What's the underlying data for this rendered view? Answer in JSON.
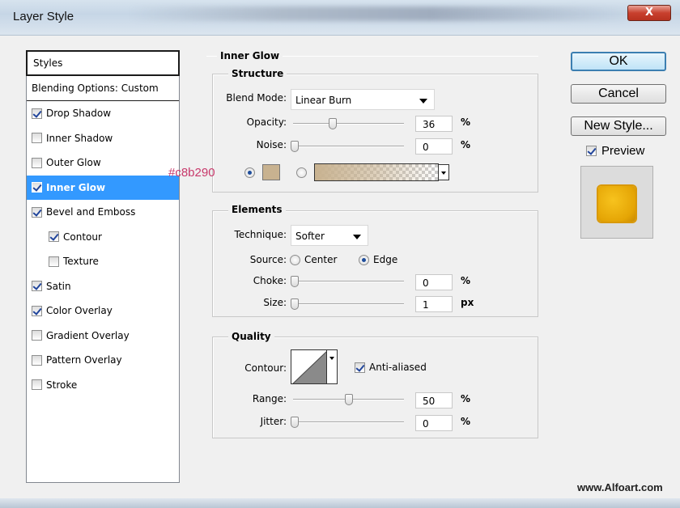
{
  "window": {
    "title": "Layer Style",
    "close_glyph": "X"
  },
  "styles_panel": {
    "header": "Styles",
    "blending_options": "Blending Options: Custom",
    "items": [
      {
        "label": "Drop Shadow",
        "checked": true
      },
      {
        "label": "Inner Shadow",
        "checked": false
      },
      {
        "label": "Outer Glow",
        "checked": false
      },
      {
        "label": "Inner Glow",
        "checked": true,
        "selected": true
      },
      {
        "label": "Bevel and Emboss",
        "checked": true
      },
      {
        "label": "Contour",
        "checked": true,
        "indent": true
      },
      {
        "label": "Texture",
        "checked": false,
        "indent": true
      },
      {
        "label": "Satin",
        "checked": true
      },
      {
        "label": "Color Overlay",
        "checked": true
      },
      {
        "label": "Gradient Overlay",
        "checked": false
      },
      {
        "label": "Pattern Overlay",
        "checked": false
      },
      {
        "label": "Stroke",
        "checked": false
      }
    ]
  },
  "inner_glow": {
    "title": "Inner Glow",
    "structure": {
      "title": "Structure",
      "blend_mode_label": "Blend Mode:",
      "blend_mode_value": "Linear Burn",
      "opacity_label": "Opacity:",
      "opacity_value": "36",
      "opacity_level": 0.36,
      "opacity_unit": "%",
      "noise_label": "Noise:",
      "noise_value": "0",
      "noise_unit": "%",
      "color_annotation": "#c8b290",
      "glow_color": "#c8b290",
      "solid_color_selected": true
    },
    "elements": {
      "title": "Elements",
      "technique_label": "Technique:",
      "technique_value": "Softer",
      "source_label": "Source:",
      "source_center": "Center",
      "source_edge": "Edge",
      "source_selected": "Edge",
      "choke_label": "Choke:",
      "choke_value": "0",
      "choke_unit": "%",
      "size_label": "Size:",
      "size_value": "1",
      "size_unit": "px"
    },
    "quality": {
      "title": "Quality",
      "contour_label": "Contour:",
      "anti_aliased_label": "Anti-aliased",
      "anti_aliased_checked": true,
      "range_label": "Range:",
      "range_value": "50",
      "range_unit": "%",
      "jitter_label": "Jitter:",
      "jitter_value": "0",
      "jitter_unit": "%"
    }
  },
  "buttons": {
    "ok": "OK",
    "cancel": "Cancel",
    "new_style": "New Style..."
  },
  "preview": {
    "label": "Preview",
    "checked": true
  },
  "watermark": "www.Alfoart.com"
}
